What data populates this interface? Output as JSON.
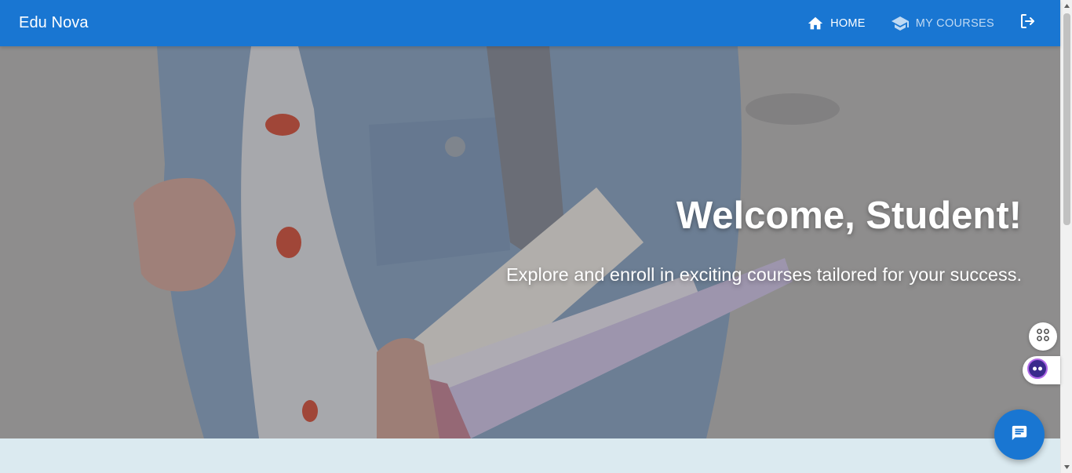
{
  "app": {
    "brand": "Edu Nova"
  },
  "nav": {
    "home_label": "HOME",
    "courses_label": "MY COURSES",
    "home_icon": "home-icon",
    "courses_icon": "school-icon",
    "logout_icon": "logout-icon"
  },
  "hero": {
    "title": "Welcome, Student!",
    "subtitle": "Explore and enroll in exciting courses tailored for your success."
  },
  "widgets": {
    "grid_icon": "command-grid-icon",
    "bot_icon": "assistant-bot-icon",
    "chat_icon": "chat-icon"
  },
  "colors": {
    "primary": "#1976d2",
    "band": "#dbeaf0"
  }
}
